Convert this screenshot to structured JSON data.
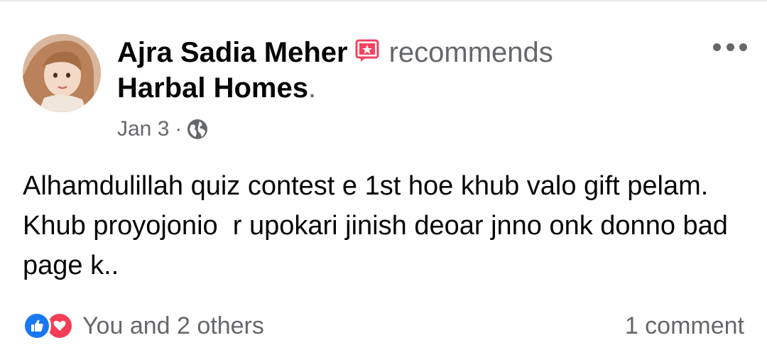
{
  "post": {
    "author": "Ajra Sadia Meher",
    "action": "recommends",
    "page": "Harbal Homes",
    "period": ".",
    "date": "Jan 3",
    "separator": "·",
    "audience_icon": "globe-icon",
    "body": "Alhamdulillah quiz contest e 1st hoe khub valo gift pelam.  Khub proyojonio  r upokari jinish deoar jnno onk donno bad page k..",
    "reactions_text": "You and 2 others",
    "comments_text": "1 comment"
  },
  "colors": {
    "text": "#050505",
    "secondary": "#65676b",
    "like": "#1877f2",
    "love": "#f33e58",
    "recommend_badge": "#f3425f"
  }
}
